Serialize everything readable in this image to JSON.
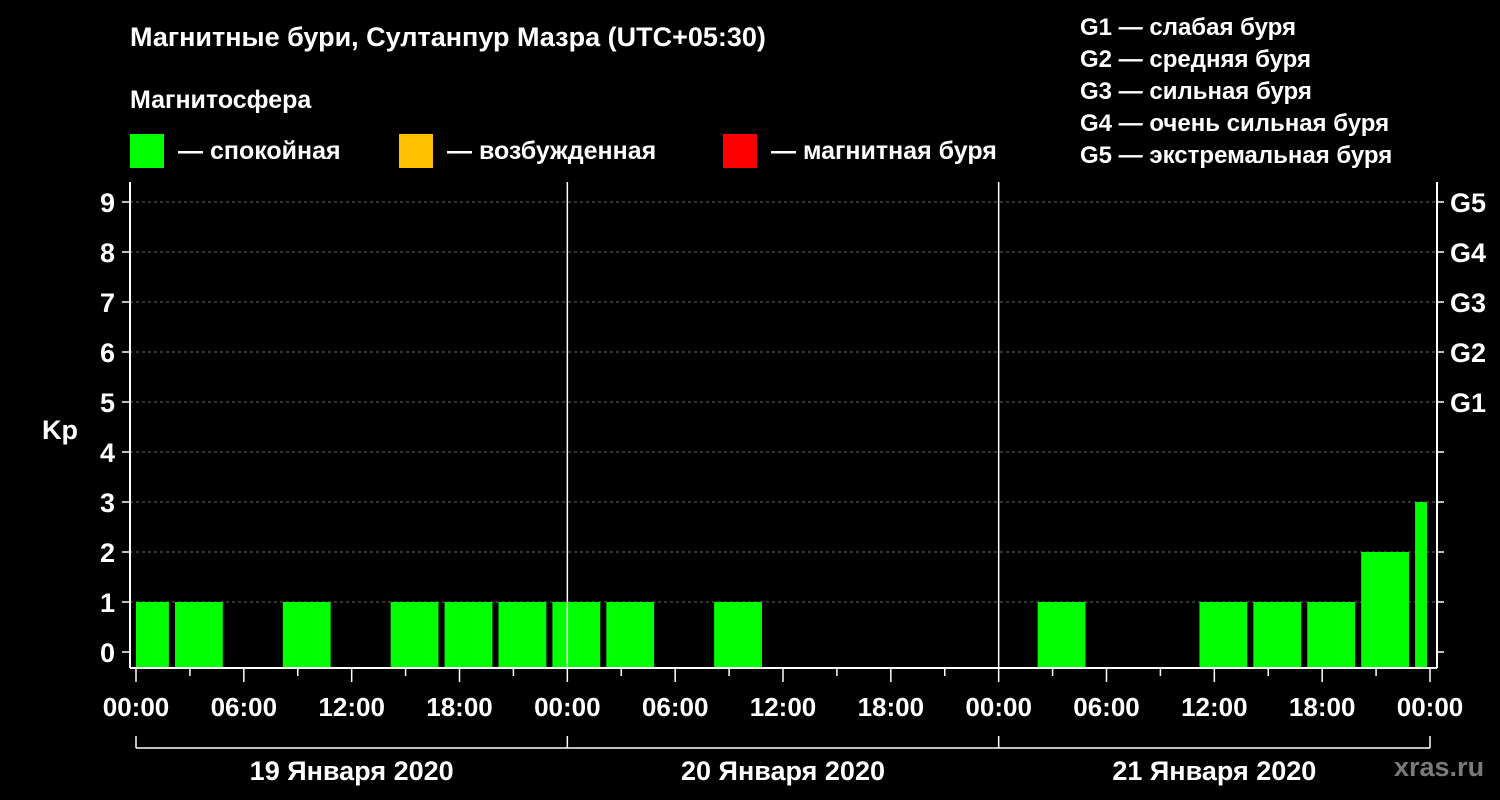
{
  "title": "Магнитные бури, Султанпур Мазра (UTC+05:30)",
  "subtitle": "Магнитосфера",
  "legend": [
    {
      "label": "— спокойная",
      "color": "#00ff00"
    },
    {
      "label": "— возбужденная",
      "color": "#ffc000"
    },
    {
      "label": "— магнитная буря",
      "color": "#ff0000"
    }
  ],
  "g_legend": [
    "G1 — слабая буря",
    "G2 — средняя буря",
    "G3 — сильная буря",
    "G4 — очень сильная буря",
    "G5 — экстремальная буря"
  ],
  "watermark": "xras.ru",
  "chart_data": {
    "type": "bar",
    "ylabel": "Kp",
    "ylim": [
      0,
      9
    ],
    "yticks": [
      0,
      1,
      2,
      3,
      4,
      5,
      6,
      7,
      8,
      9
    ],
    "y2ticks": [
      {
        "value": 5,
        "label": "G1"
      },
      {
        "value": 6,
        "label": "G2"
      },
      {
        "value": 7,
        "label": "G3"
      },
      {
        "value": 8,
        "label": "G4"
      },
      {
        "value": 9,
        "label": "G5"
      }
    ],
    "x_range_hours": [
      0,
      72
    ],
    "x_tick_labels": [
      "00:00",
      "06:00",
      "12:00",
      "18:00",
      "00:00",
      "06:00",
      "12:00",
      "18:00",
      "00:00",
      "06:00",
      "12:00",
      "18:00",
      "00:00"
    ],
    "days": [
      "19 Января 2020",
      "20 Января 2020",
      "21 Января 2020"
    ],
    "grid": true,
    "bar_color": "#00ff00",
    "bars": [
      {
        "start": 0,
        "end": 1.83,
        "kp": 1
      },
      {
        "start": 2.17,
        "end": 4.83,
        "kp": 1
      },
      {
        "start": 8.17,
        "end": 10.83,
        "kp": 1
      },
      {
        "start": 14.17,
        "end": 16.83,
        "kp": 1
      },
      {
        "start": 17.17,
        "end": 19.83,
        "kp": 1
      },
      {
        "start": 20.17,
        "end": 22.83,
        "kp": 1
      },
      {
        "start": 23.17,
        "end": 25.83,
        "kp": 1
      },
      {
        "start": 26.17,
        "end": 28.83,
        "kp": 1
      },
      {
        "start": 32.17,
        "end": 34.83,
        "kp": 1
      },
      {
        "start": 50.17,
        "end": 52.83,
        "kp": 1
      },
      {
        "start": 59.17,
        "end": 61.83,
        "kp": 1
      },
      {
        "start": 62.17,
        "end": 64.83,
        "kp": 1
      },
      {
        "start": 65.17,
        "end": 67.83,
        "kp": 1
      },
      {
        "start": 68.17,
        "end": 70.83,
        "kp": 2
      },
      {
        "start": 71.17,
        "end": 71.83,
        "kp": 3
      }
    ]
  }
}
